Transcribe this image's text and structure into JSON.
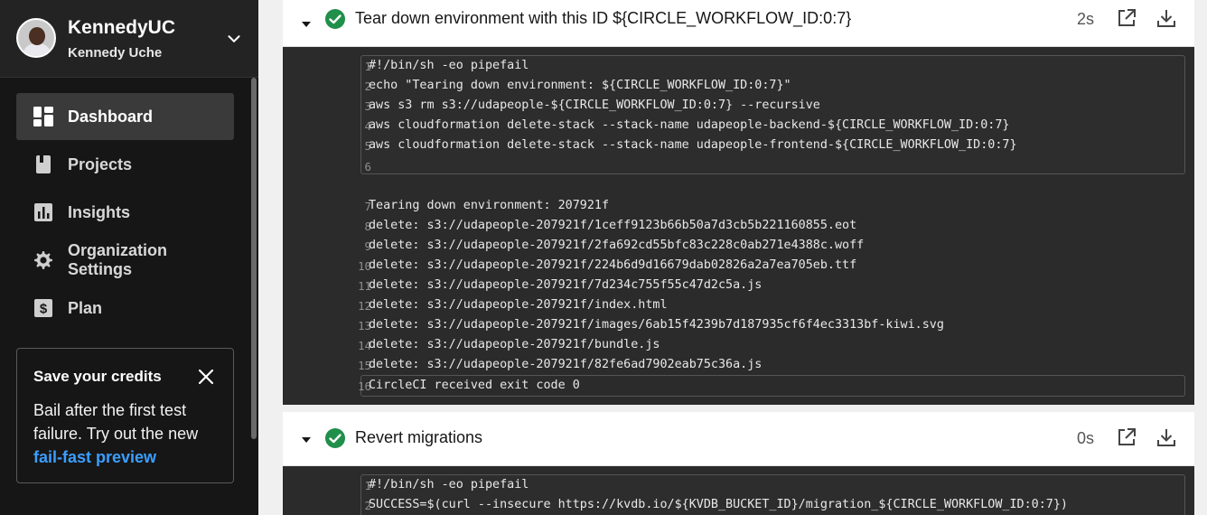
{
  "sidebar": {
    "org_name": "KennedyUC",
    "user_name": "Kennedy Uche",
    "items": [
      {
        "label": "Dashboard",
        "icon": "dashboard-icon"
      },
      {
        "label": "Projects",
        "icon": "book-icon"
      },
      {
        "label": "Insights",
        "icon": "bar-chart-icon"
      },
      {
        "label": "Organization Settings",
        "icon": "gear-icon"
      },
      {
        "label": "Plan",
        "icon": "dollar-icon"
      }
    ],
    "credits": {
      "title": "Save your credits",
      "body": "Bail after the first test failure. Try out the new",
      "link": "fail-fast preview"
    }
  },
  "steps": [
    {
      "title": "Tear down environment with this ID ${CIRCLE_WORKFLOW_ID:0:7}",
      "duration": "2s",
      "status": "success",
      "command_lines": [
        {
          "n": "1",
          "text": "#!/bin/sh -eo pipefail"
        },
        {
          "n": "2",
          "text": "echo \"Tearing down environment: ${CIRCLE_WORKFLOW_ID:0:7}\""
        },
        {
          "n": "3",
          "text": "aws s3 rm s3://udapeople-${CIRCLE_WORKFLOW_ID:0:7} --recursive"
        },
        {
          "n": "4",
          "text": "aws cloudformation delete-stack --stack-name udapeople-backend-${CIRCLE_WORKFLOW_ID:0:7}"
        },
        {
          "n": "5",
          "text": "aws cloudformation delete-stack --stack-name udapeople-frontend-${CIRCLE_WORKFLOW_ID:0:7}"
        },
        {
          "n": "6",
          "text": ""
        }
      ],
      "output_lines": [
        {
          "n": "7",
          "text": "Tearing down environment: 207921f"
        },
        {
          "n": "8",
          "text": "delete: s3://udapeople-207921f/1ceff9123b66b50a7d3cb5b221160855.eot"
        },
        {
          "n": "9",
          "text": "delete: s3://udapeople-207921f/2fa692cd55bfc83c228c0ab271e4388c.woff"
        },
        {
          "n": "10",
          "text": "delete: s3://udapeople-207921f/224b6d9d16679dab02826a2a7ea705eb.ttf"
        },
        {
          "n": "11",
          "text": "delete: s3://udapeople-207921f/7d234c755f55c47d2c5a.js"
        },
        {
          "n": "12",
          "text": "delete: s3://udapeople-207921f/index.html"
        },
        {
          "n": "13",
          "text": "delete: s3://udapeople-207921f/images/6ab15f4239b7d187935cf6f4ec3313bf-kiwi.svg"
        },
        {
          "n": "14",
          "text": "delete: s3://udapeople-207921f/bundle.js"
        },
        {
          "n": "15",
          "text": "delete: s3://udapeople-207921f/82fe6ad7902eab75c36a.js"
        }
      ],
      "exit_line": {
        "n": "16",
        "text": "CircleCI received exit code 0"
      }
    },
    {
      "title": "Revert migrations",
      "duration": "0s",
      "status": "success",
      "command_lines": [
        {
          "n": "1",
          "text": "#!/bin/sh -eo pipefail"
        },
        {
          "n": "2",
          "text": "SUCCESS=$(curl --insecure https://kvdb.io/${KVDB_BUCKET_ID}/migration_${CIRCLE_WORKFLOW_ID:0:7})"
        }
      ]
    }
  ],
  "colors": {
    "sidebar_bg": "#161616",
    "success_green": "#1f8f4a",
    "link_blue": "#3b9eff",
    "console_bg": "#2b2b2b"
  }
}
